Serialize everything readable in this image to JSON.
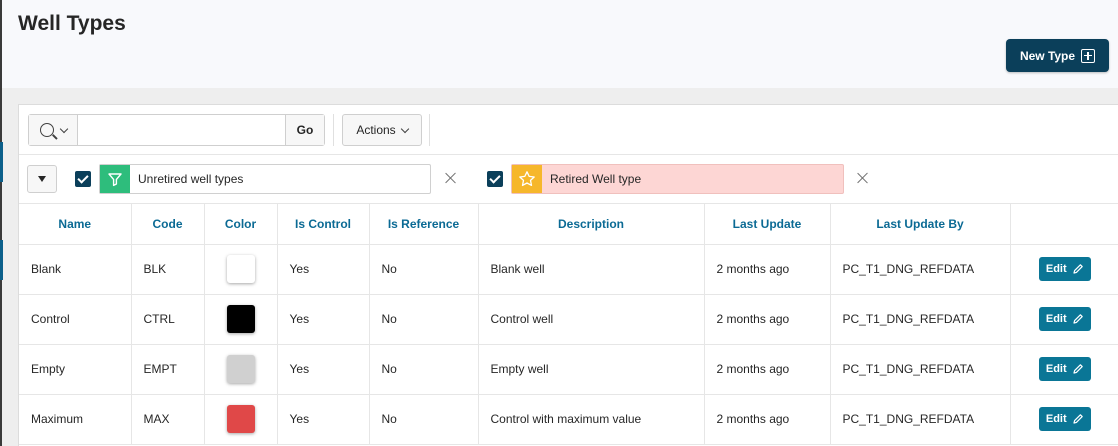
{
  "page": {
    "title": "Well Types",
    "new_button_label": "New Type"
  },
  "toolbar": {
    "search_value": "",
    "search_placeholder": "",
    "go_label": "Go",
    "actions_label": "Actions"
  },
  "filters": [
    {
      "label": "Unretired well types",
      "checked": true,
      "icon": "funnel-icon",
      "color": "#2ebd7c"
    },
    {
      "label": "Retired Well type",
      "checked": true,
      "icon": "star-icon",
      "color": "#f6b72b"
    }
  ],
  "table": {
    "columns": [
      "Name",
      "Code",
      "Color",
      "Is Control",
      "Is Reference",
      "Description",
      "Last Update",
      "Last Update By",
      ""
    ],
    "rows": [
      {
        "name": "Blank",
        "code": "BLK",
        "color": "#ffffff",
        "is_control": "Yes",
        "is_reference": "No",
        "description": "Blank well",
        "last_update": "2 months ago",
        "last_update_by": "PC_T1_DNG_REFDATA",
        "action": "Edit"
      },
      {
        "name": "Control",
        "code": "CTRL",
        "color": "#000000",
        "is_control": "Yes",
        "is_reference": "No",
        "description": "Control well",
        "last_update": "2 months ago",
        "last_update_by": "PC_T1_DNG_REFDATA",
        "action": "Edit"
      },
      {
        "name": "Empty",
        "code": "EMPT",
        "color": "#d0d0d0",
        "is_control": "Yes",
        "is_reference": "No",
        "description": "Empty well",
        "last_update": "2 months ago",
        "last_update_by": "PC_T1_DNG_REFDATA",
        "action": "Edit"
      },
      {
        "name": "Maximum",
        "code": "MAX",
        "color": "#e04848",
        "is_control": "Yes",
        "is_reference": "No",
        "description": "Control with maximum value",
        "last_update": "2 months ago",
        "last_update_by": "PC_T1_DNG_REFDATA",
        "action": "Edit"
      }
    ]
  },
  "colors": {
    "brand_dark": "#0b3f5a",
    "header_link": "#0b6a94",
    "edit_button": "#0a7696"
  }
}
